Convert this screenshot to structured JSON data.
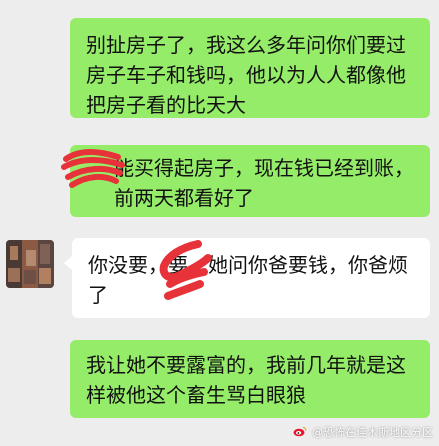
{
  "messages": [
    {
      "side": "out",
      "text": "别扯房子了，我这么多年问你们要过房子车子和钱吗，他以为人人都像他把房子看的比天大"
    },
    {
      "side": "out",
      "text": "能买得起房子，现在钱已经到账，前两天都看好了"
    },
    {
      "side": "in",
      "text": "你没要，要，她问你爸要钱，你爸烦了"
    },
    {
      "side": "out",
      "text": "我让她不要露富的，我前几年就是这样被他这个畜生骂白眼狼"
    }
  ],
  "watermark": {
    "text": "@恐怖在佳木斯地区分区",
    "icon": "weibo-icon"
  },
  "colors": {
    "background": "#ededed",
    "outgoing_bubble": "#95ec69",
    "incoming_bubble": "#ffffff",
    "redaction_scribble": "#e8323a"
  },
  "avatar": {
    "icon": "avatar-image"
  }
}
